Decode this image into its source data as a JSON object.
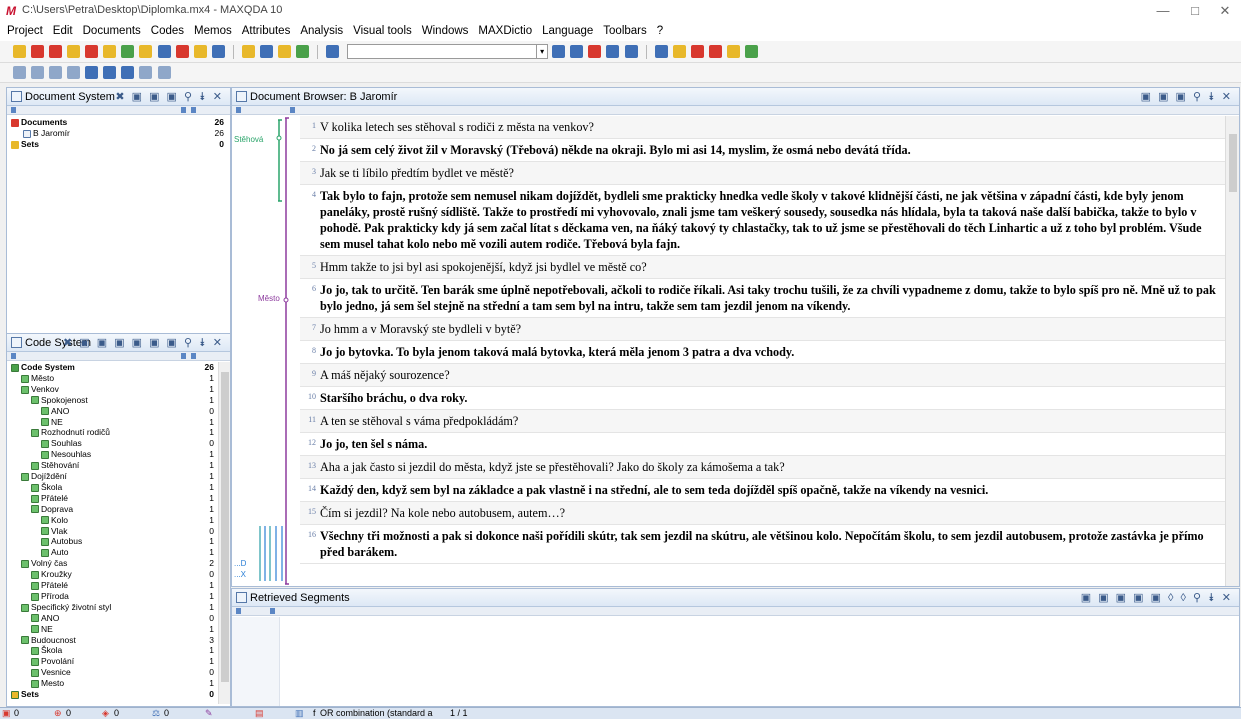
{
  "window": {
    "title": "C:\\Users\\Petra\\Desktop\\Diplomka.mx4 - MAXQDA 10",
    "logo": "M"
  },
  "menu": [
    "Project",
    "Edit",
    "Documents",
    "Codes",
    "Memos",
    "Attributes",
    "Analysis",
    "Visual tools",
    "Windows",
    "MAXDictio",
    "Language",
    "Toolbars",
    "?"
  ],
  "toolbar_colors": {
    "accent_red": "#d8382e",
    "accent_yellow": "#e8b82a",
    "accent_blue": "#3f6fb6",
    "accent_green": "#4aa14a"
  },
  "document_system": {
    "title": "Document System",
    "items": [
      {
        "label": "Documents",
        "count": "26",
        "bold": true,
        "icon": "documents-icon"
      },
      {
        "label": "B Jaromír",
        "count": "26",
        "bold": false,
        "icon": "document-icon"
      },
      {
        "label": "Sets",
        "count": "0",
        "bold": true,
        "icon": "sets-icon"
      }
    ]
  },
  "code_system": {
    "title": "Code System",
    "items": [
      {
        "label": "Code System",
        "count": "26",
        "depth": 0,
        "bold": true
      },
      {
        "label": "Město",
        "count": "1",
        "depth": 1
      },
      {
        "label": "Venkov",
        "count": "1",
        "depth": 1
      },
      {
        "label": "Spokojenost",
        "count": "1",
        "depth": 2
      },
      {
        "label": "ANO",
        "count": "0",
        "depth": 3
      },
      {
        "label": "NE",
        "count": "1",
        "depth": 3
      },
      {
        "label": "Rozhodnutí rodičů",
        "count": "1",
        "depth": 2
      },
      {
        "label": "Souhlas",
        "count": "0",
        "depth": 3
      },
      {
        "label": "Nesouhlas",
        "count": "1",
        "depth": 3
      },
      {
        "label": "Stěhování",
        "count": "1",
        "depth": 2
      },
      {
        "label": "Dojíždění",
        "count": "1",
        "depth": 1
      },
      {
        "label": "Škola",
        "count": "1",
        "depth": 2
      },
      {
        "label": "Přátelé",
        "count": "1",
        "depth": 2
      },
      {
        "label": "Doprava",
        "count": "1",
        "depth": 2
      },
      {
        "label": "Kolo",
        "count": "1",
        "depth": 3
      },
      {
        "label": "Vlak",
        "count": "0",
        "depth": 3
      },
      {
        "label": "Autobus",
        "count": "1",
        "depth": 3
      },
      {
        "label": "Auto",
        "count": "1",
        "depth": 3
      },
      {
        "label": "Volný čas",
        "count": "2",
        "depth": 1
      },
      {
        "label": "Kroužky",
        "count": "0",
        "depth": 2
      },
      {
        "label": "Přátelé",
        "count": "1",
        "depth": 2
      },
      {
        "label": "Příroda",
        "count": "1",
        "depth": 2
      },
      {
        "label": "Specifický životní styl",
        "count": "1",
        "depth": 1
      },
      {
        "label": "ANO",
        "count": "0",
        "depth": 2
      },
      {
        "label": "NE",
        "count": "1",
        "depth": 2
      },
      {
        "label": "Budoucnost",
        "count": "3",
        "depth": 1
      },
      {
        "label": "Škola",
        "count": "1",
        "depth": 2
      },
      {
        "label": "Povolání",
        "count": "1",
        "depth": 2
      },
      {
        "label": "Vesnice",
        "count": "0",
        "depth": 2
      },
      {
        "label": "Mesto",
        "count": "1",
        "depth": 2
      },
      {
        "label": "Sets",
        "count": "0",
        "depth": 0,
        "bold": true
      }
    ]
  },
  "document_browser": {
    "title": "Document Browser: B Jaromír",
    "code_labels": [
      "Stěhová",
      "Město",
      "...D",
      "...X"
    ],
    "paragraphs": [
      {
        "n": "1",
        "text": "V kolika letech ses stěhoval s rodiči z města na venkov?",
        "bold": false
      },
      {
        "n": "2",
        "text": "No já sem celý život žil v Moravský (Třebová) někde na okraji. Bylo mi asi 14, myslim, že osmá nebo devátá třída.",
        "bold": true
      },
      {
        "n": "3",
        "text": "Jak se ti líbilo předtím bydlet ve městě?",
        "bold": false
      },
      {
        "n": "4",
        "text": "Tak bylo to fajn, protože sem nemusel nikam dojíždět, bydleli sme prakticky hnedka vedle školy v takové klidnější části, ne jak většina v západní části, kde byly jenom paneláky, prostě rušný sídliště. Takže to prostředí mi vyhovovalo, znali jsme tam veškerý sousedy, sousedka nás hlídala, byla ta taková naše další babička, takže to bylo v pohodě. Pak prakticky kdy já sem začal lítat s děckama ven, na ňáký takový ty chlastačky, tak to už jsme se přestěhovali do těch Linhartic a už z toho byl problém. Všude sem musel tahat kolo nebo mě vozili autem rodiče. Třebová byla fajn.",
        "bold": true
      },
      {
        "n": "5",
        "text": "Hmm takže to jsi byl asi spokojenější, když jsi bydlel ve městě co?",
        "bold": false
      },
      {
        "n": "6",
        "text": "Jo jo, tak to určitě. Ten barák sme úplně nepotřebovali, ačkoli to rodiče říkali. Asi taky trochu tušili, že za chvíli vypadneme z domu, takže to bylo spíš pro ně. Mně už to pak bylo jedno, já sem šel stejně na střední a tam sem byl na intru, takže sem tam jezdil jenom na víkendy.",
        "bold": true
      },
      {
        "n": "7",
        "text": "Jo hmm a v Moravský ste bydleli v bytě?",
        "bold": false
      },
      {
        "n": "8",
        "text": "Jo jo bytovka. To byla jenom taková malá bytovka, která měla jenom 3 patra a dva vchody.",
        "bold": true
      },
      {
        "n": "9",
        "text": "A máš nějaký sourozence?",
        "bold": false
      },
      {
        "n": "10",
        "text": "Staršího bráchu, o dva roky.",
        "bold": true
      },
      {
        "n": "11",
        "text": "A ten se stěhoval s váma předpokládám?",
        "bold": false
      },
      {
        "n": "12",
        "text": "Jo jo, ten šel s náma.",
        "bold": true
      },
      {
        "n": "13",
        "text": "Aha a jak často si jezdil do města, když jste se přestěhovali? Jako do školy za kámošema a tak?",
        "bold": false
      },
      {
        "n": "14",
        "text": "Každý den, když sem byl na základce a pak vlastně i na střední, ale to sem teda dojížděl spíš opačně, takže na víkendy na vesnici.",
        "bold": true
      },
      {
        "n": "15",
        "text": "Čím si jezdil? Na kole nebo autobusem, autem…?",
        "bold": false
      },
      {
        "n": "16",
        "text": "Všechny tři možnosti a pak si dokonce naši pořídili skútr, tak sem jezdil na skútru, ale většinou kolo. Nepočítám školu, to sem jezdil autobusem, protože zastávka je přímo před barákem.",
        "bold": true
      }
    ]
  },
  "retrieved_segments": {
    "title": "Retrieved Segments"
  },
  "status": {
    "count_docs": "0",
    "count_codes": "0",
    "count_a": "0",
    "count_b": "0",
    "mode": "OR combination (standard a",
    "page": "1 / 1"
  }
}
